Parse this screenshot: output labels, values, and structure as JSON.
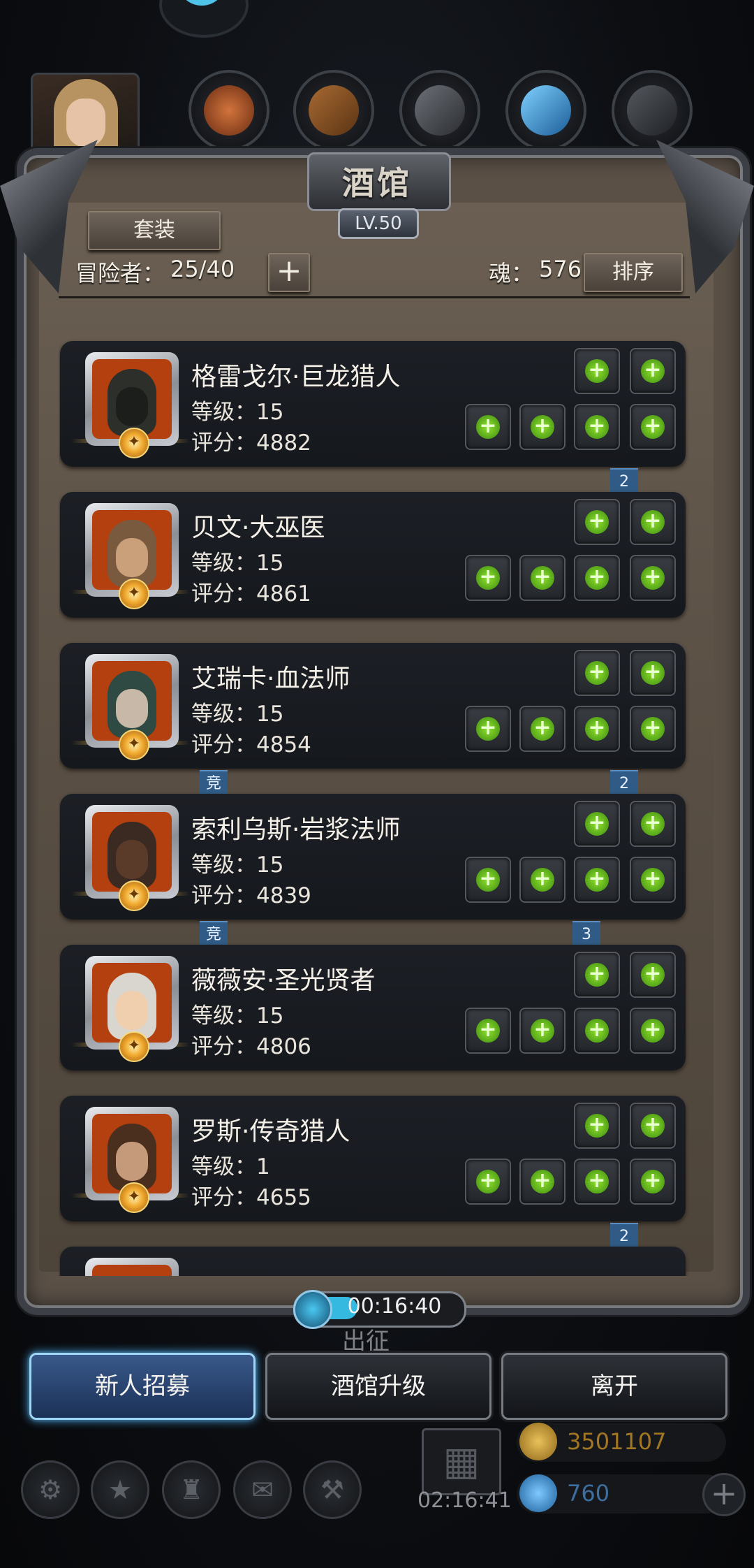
{
  "header": {
    "title": "酒馆",
    "level": "LV.50",
    "suit_button": "套装",
    "adventurers_label": "冒险者：",
    "adventurers_value": "25/40",
    "add_button": "+",
    "soul_label": "魂：",
    "soul_value": "576",
    "sort_button": "排序"
  },
  "heroes": [
    {
      "name": "格雷戈尔·巨龙猎人",
      "level": "等级：15",
      "score": "评分：4882",
      "ribbon": "2"
    },
    {
      "name": "贝文·大巫医",
      "level": "等级：15",
      "score": "评分：4861",
      "ribbon": ""
    },
    {
      "name": "艾瑞卡·血法师",
      "level": "等级：15",
      "score": "评分：4854",
      "ribbon": "2",
      "tag": "竞"
    },
    {
      "name": "索利乌斯·岩浆法师",
      "level": "等级：15",
      "score": "评分：4839",
      "ribbon": "3",
      "tag": "竞"
    },
    {
      "name": "薇薇安·圣光贤者",
      "level": "等级：15",
      "score": "评分：4806",
      "ribbon": ""
    },
    {
      "name": "罗斯·传奇猎人",
      "level": "等级：1",
      "score": "评分：4655",
      "ribbon": "2"
    }
  ],
  "timer": "00:16:40",
  "expedition_label": "出征",
  "buttons": {
    "recruit": "新人招募",
    "upgrade": "酒馆升级",
    "leave": "离开"
  },
  "footer": {
    "gift_timer": "02:16:41",
    "gold": "3501107",
    "gems": "760",
    "add_currency": "+"
  },
  "colors": {
    "accent_green": "#6cc522",
    "ribbon_blue": "#2f5b86",
    "primary_button_glow": "#4fb6ff"
  },
  "icons": [
    "mascot-icon",
    "meat-resource-icon",
    "wood-resource-icon",
    "iron-resource-icon",
    "crystal-resource-icon",
    "stone-resource-icon",
    "settings-icon",
    "star-icon",
    "guild-icon",
    "mail-icon",
    "forge-icon",
    "gift-icon",
    "gold-coin-icon",
    "gem-icon",
    "plus-icon"
  ]
}
